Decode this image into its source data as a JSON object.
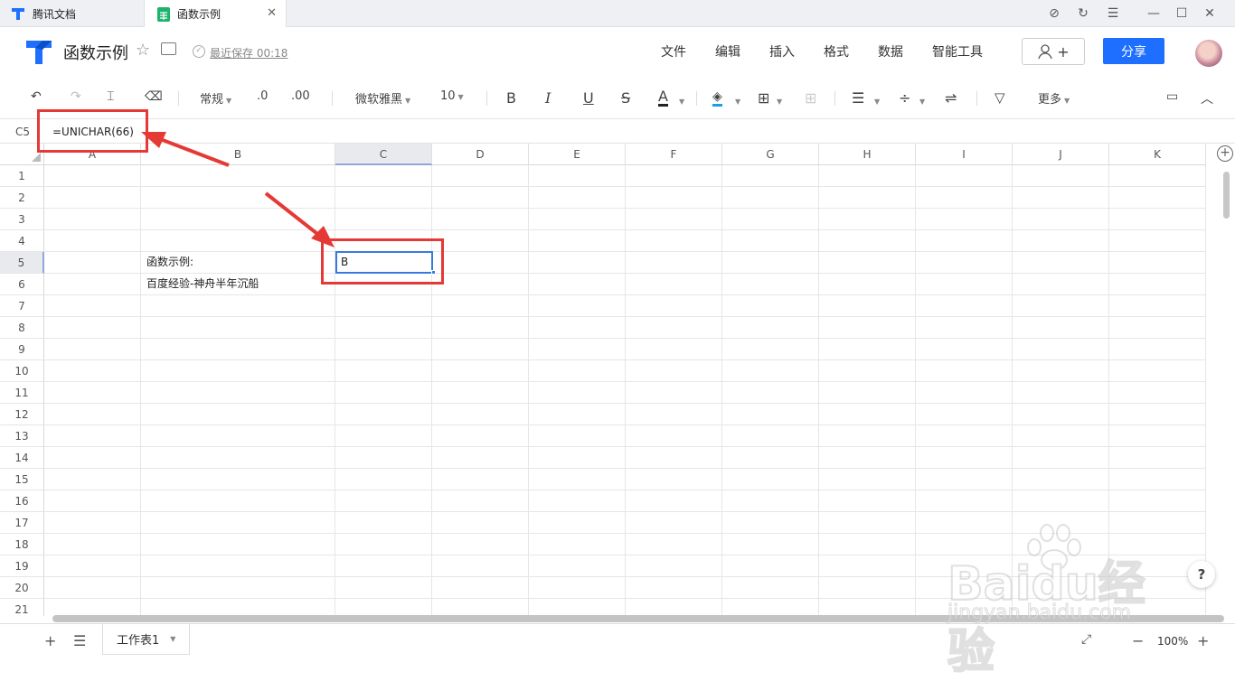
{
  "window": {
    "tabs": [
      {
        "label": "腾讯文档",
        "icon": "tencent-docs-icon",
        "active": false
      },
      {
        "label": "函数示例",
        "icon": "spreadsheet-icon",
        "active": true
      }
    ],
    "controls": [
      "compass-icon",
      "refresh-icon",
      "menu-icon",
      "minimize-icon",
      "maximize-icon",
      "close-icon"
    ]
  },
  "header": {
    "title": "函数示例",
    "save_status": "最近保存 00:18",
    "menus": [
      "文件",
      "编辑",
      "插入",
      "格式",
      "数据",
      "智能工具"
    ],
    "invite_label": "+",
    "share_label": "分享"
  },
  "toolbar": {
    "number_format": "常规",
    "decimal_decrease": ".0",
    "decimal_increase": ".00",
    "font_name": "微软雅黑",
    "font_size": "10",
    "bold": "B",
    "italic": "I",
    "underline": "U",
    "strike": "S",
    "font_color_glyph": "A",
    "more_label": "更多",
    "colors": {
      "font_color": "#222222",
      "fill_color": "#1aa0e0"
    }
  },
  "formula_bar": {
    "cell_ref": "C5",
    "formula": "=UNICHAR(66)"
  },
  "grid": {
    "columns": [
      "A",
      "B",
      "C",
      "D",
      "E",
      "F",
      "G",
      "H",
      "I",
      "J",
      "K"
    ],
    "selected_column": "C",
    "rows": [
      "1",
      "2",
      "3",
      "4",
      "5",
      "6",
      "7",
      "8",
      "9",
      "10",
      "11",
      "12",
      "13",
      "14",
      "15",
      "16",
      "17",
      "18",
      "19",
      "20",
      "21"
    ],
    "selected_row": "5",
    "cells": {
      "B5": "函数示例:",
      "B6": "百度经验-神舟半年沉船",
      "C5": "B"
    }
  },
  "bottom": {
    "sheet_name": "工作表1",
    "zoom": "100%"
  },
  "watermark": {
    "brand": "Baidu经验",
    "url": "jingyan.baidu.com"
  },
  "help_label": "?",
  "colors": {
    "accent": "#1e6fff",
    "annotation_red": "#e53935",
    "selection_blue": "#3a78e0"
  }
}
